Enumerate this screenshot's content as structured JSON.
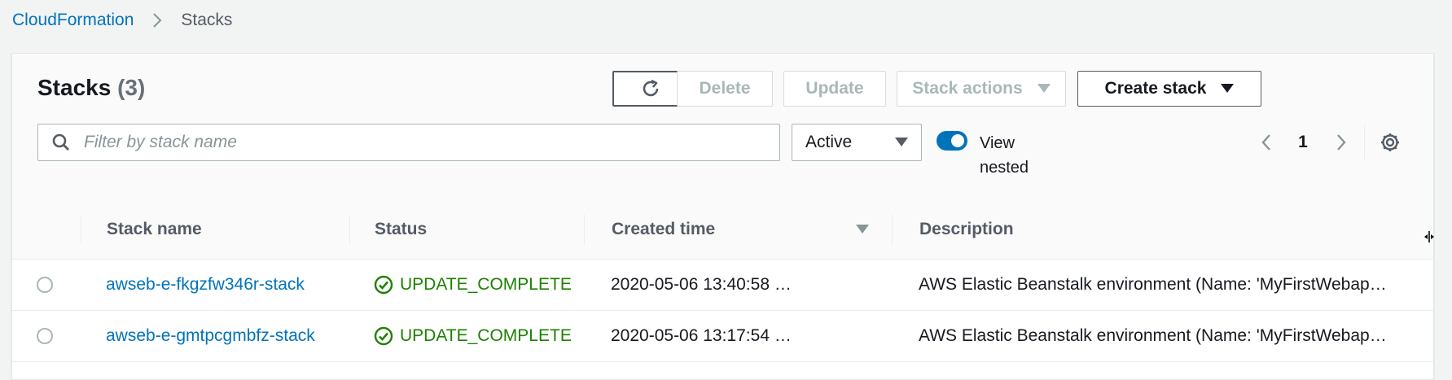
{
  "breadcrumb": {
    "parent": "CloudFormation",
    "current": "Stacks"
  },
  "header": {
    "title": "Stacks",
    "count": "(3)"
  },
  "toolbar": {
    "delete_label": "Delete",
    "update_label": "Update",
    "stack_actions_label": "Stack actions",
    "create_stack_label": "Create stack"
  },
  "filter": {
    "placeholder": "Filter by stack name",
    "value": ""
  },
  "status_filter": {
    "selected": "Active"
  },
  "view_nested": {
    "label": "View nested",
    "enabled": true
  },
  "pagination": {
    "current_page": "1"
  },
  "table": {
    "columns": [
      "Stack name",
      "Status",
      "Created time",
      "Description"
    ],
    "sort_column": "Created time",
    "sort_direction": "descending",
    "rows": [
      {
        "stack_name": "awseb-e-fkgzfw346r-stack",
        "status": "UPDATE_COMPLETE",
        "created_time": "2020-05-06 13:40:58 …",
        "description": "AWS Elastic Beanstalk environment (Name: 'MyFirstWebap…"
      },
      {
        "stack_name": "awseb-e-gmtpcgmbfz-stack",
        "status": "UPDATE_COMPLETE",
        "created_time": "2020-05-06 13:17:54 …",
        "description": "AWS Elastic Beanstalk environment (Name: 'MyFirstWebap…"
      }
    ]
  },
  "colors": {
    "link": "#0073bb",
    "success": "#1d8102",
    "toggle_on": "#0073bb"
  },
  "icons": [
    "chevron-right-icon",
    "refresh-icon",
    "caret-down-icon",
    "search-icon",
    "chevron-left-icon",
    "gear-icon",
    "success-check-icon",
    "sort-descending-icon",
    "column-resize-icon"
  ]
}
